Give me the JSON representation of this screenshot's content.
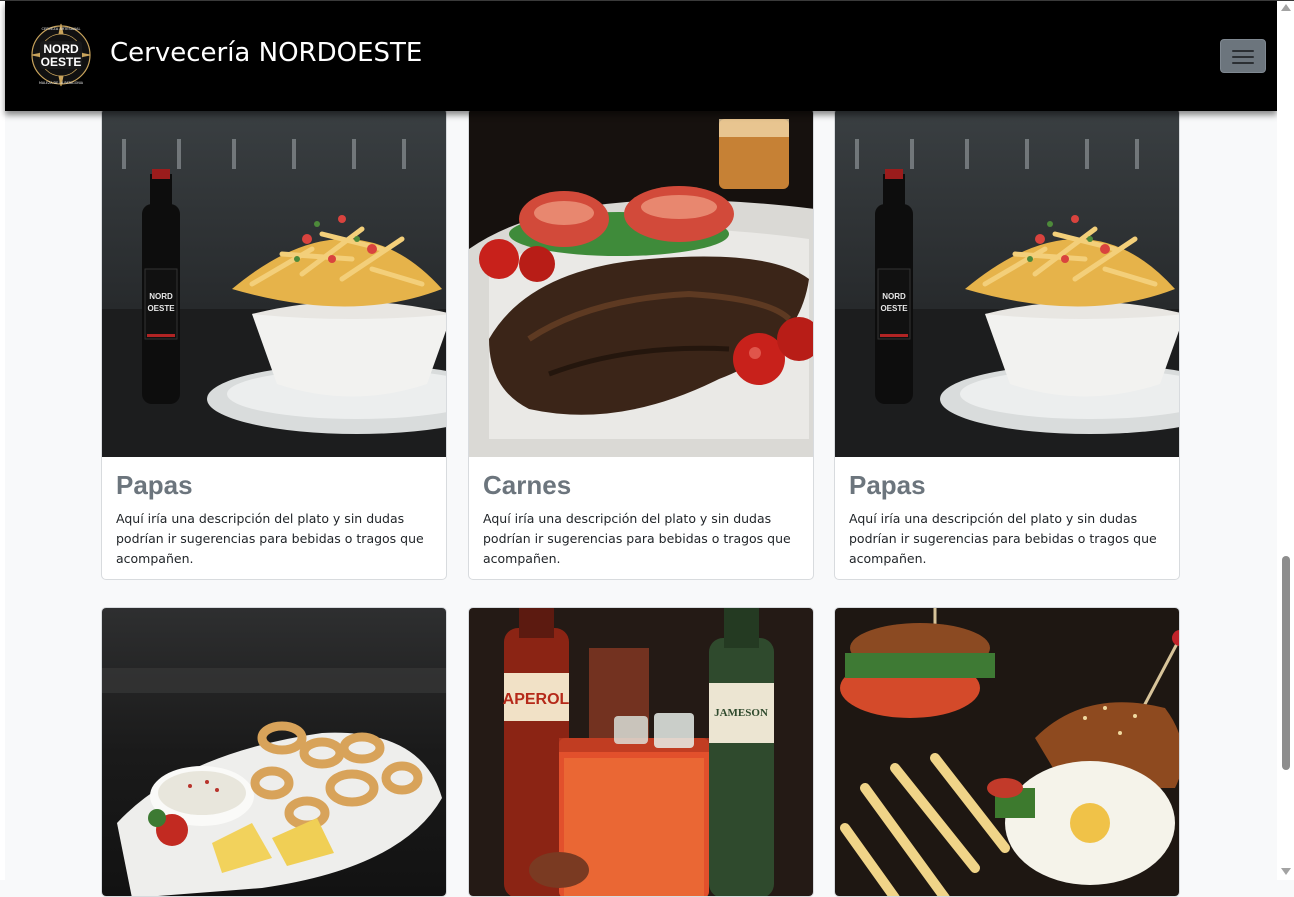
{
  "navbar": {
    "brand": "Cervecería NORDOESTE",
    "logo": {
      "top_text": "CERVEZA ARTESANAL",
      "word1": "NORD",
      "word2": "OESTE",
      "bottom_text": "MALEZA DE LA PATAGONIA"
    },
    "toggler_icon": "hamburger-icon"
  },
  "cards": [
    {
      "title": "Papas",
      "text": "Aquí iría una descripción del plato y sin dudas podrían ir sugerencias para bebidas o tragos que acompañen.",
      "image": "fries-bowl-with-beer-bottle",
      "bottle_label_top": "NORD",
      "bottle_label_bottom": "OESTE"
    },
    {
      "title": "Carnes",
      "text": "Aquí iría una descripción del plato y sin dudas podrían ir sugerencias para bebidas o tragos que acompañen.",
      "image": "grilled-steak-with-tomatoes"
    },
    {
      "title": "Papas",
      "text": "Aquí iría una descripción del plato y sin dudas podrían ir sugerencias para bebidas o tragos que acompañen.",
      "image": "fries-bowl-with-beer-bottle",
      "bottle_label_top": "NORD",
      "bottle_label_bottom": "OESTE"
    },
    {
      "image": "fried-calamari-plate"
    },
    {
      "image": "cocktail-with-bottles",
      "bottle_labels": [
        "APEROL",
        "JAMESON"
      ]
    },
    {
      "image": "burger-with-egg-and-fries"
    }
  ],
  "colors": {
    "navbar_bg": "#000000",
    "page_bg": "#f8f9fa",
    "card_title": "#6c757d",
    "toggler_bg": "#6c757d"
  }
}
